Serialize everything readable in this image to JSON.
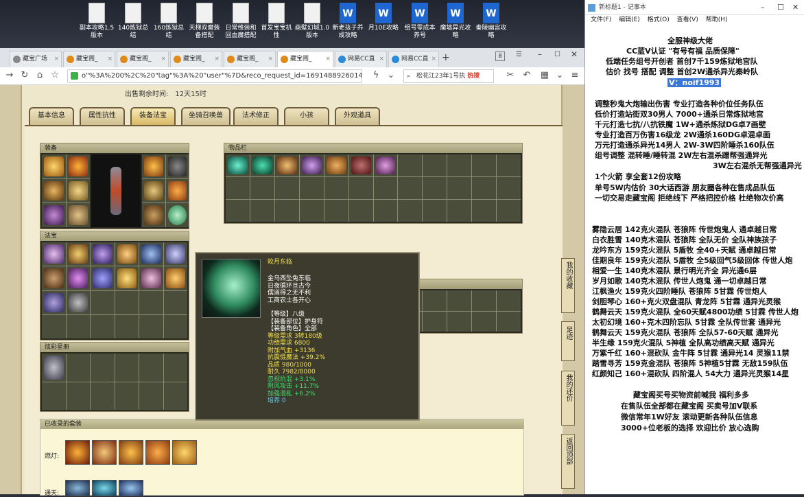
{
  "desktop": {
    "icons": [
      {
        "label": "副本攻略1.5版本",
        "type": "doc"
      },
      {
        "label": "140炼狱总结",
        "type": "doc"
      },
      {
        "label": "160炼狱总结",
        "type": "doc"
      },
      {
        "label": "天梯双魔装备搭配",
        "type": "doc"
      },
      {
        "label": "日常维装和回血魔搭配",
        "type": "doc"
      },
      {
        "label": "首发宝宝机性",
        "type": "doc"
      },
      {
        "label": "画壁幻城1.0版本",
        "type": "doc"
      },
      {
        "label": "新老孩子养成攻略",
        "type": "word"
      },
      {
        "label": "月10E攻略",
        "type": "word"
      },
      {
        "label": "组号零成本养号",
        "type": "word"
      },
      {
        "label": "魔墟异光攻略",
        "type": "word"
      },
      {
        "label": "秦陵幽宫攻略",
        "type": "word"
      }
    ]
  },
  "browser": {
    "tabs": [
      {
        "label": "藏宝广场"
      },
      {
        "label": "藏宝阁_"
      },
      {
        "label": "藏宝阁_"
      },
      {
        "label": "藏宝阁_"
      },
      {
        "label": "藏宝阁_"
      },
      {
        "label": "藏宝阁_"
      },
      {
        "label": "网易CC直"
      },
      {
        "label": "网易CC直"
      }
    ],
    "tab_count": "8",
    "url": "o\"%3A%200%2C%20\"tag\"%3A%20\"user\"%7D&reco_request_id=1691488926014emeD5",
    "search_text": "松花江23年1号执",
    "search_hot": "热搜"
  },
  "game": {
    "sale_label": "出售剩余时间:",
    "sale_time": "12天15时",
    "tabs": [
      "基本信息",
      "属性抗性",
      "装备法宝",
      "坐骑召唤兽",
      "法术修正",
      "小孩",
      "外观道具"
    ],
    "active_tab": "装备法宝",
    "panels": {
      "equipment": "装备",
      "inventory": "物品栏",
      "treasure": "法宝",
      "star": "炫彩星册",
      "sets": "已收录的套装"
    },
    "set_labels": [
      "燃灯:",
      "通天:"
    ],
    "tooltip": {
      "name": "皎月东临",
      "desc": [
        "金乌西坠兔东临",
        "日夜循环旦古今",
        "儒道得之无不利",
        "工商农士各开心"
      ],
      "level": "【等级】八级",
      "part": "【装备部位】护身符",
      "role": "【装备角色】全部",
      "stats_yellow": [
        "等级需求 3转180级",
        "功绩需求 6800",
        "附加气血 +3136",
        "抗震慑魔法 +39.2%",
        "品质 980/1000",
        "耐久 7982/8000"
      ],
      "stats_green": [
        "忽视抗混 +3.1%",
        "附风攻击 +11.7%",
        "加强混乱 +6.2%"
      ],
      "nurture": "培养 0"
    },
    "side_buttons": [
      "我的收藏",
      "足迹",
      "我的还价",
      "返回顶部"
    ]
  },
  "notepad": {
    "title": "新标题1 - 记事本",
    "menu": [
      "文件(F)",
      "编辑(E)",
      "格式(O)",
      "查看(V)",
      "帮助(H)"
    ],
    "lines": [
      "全服神级大佬",
      "CC蓝V认证 \"有号有福 品质保障\"",
      "低端任务组号开创者         首创7千159炼狱地宫队",
      "估价 找号 搭配 调整         首创2W通杀异光秦岭队",
      "V：noif1993",
      "调整秒鬼大炮输出伤害          专业打造各种价位任务队伍",
      "低价打造站街双30男人           7000+通杀日常炼狱地宫",
      "千元打造七抗/八抗铁魔           1W+通杀炼狱DG卓7画壁",
      "专业打造百万伤害16级龙         2W通杀160DG卓混卓画",
      "万元打造通杀异光14男人        2W-3W四阶睡杀160队伍",
      "组号调整 混转睡/睡转混          2W左右混杀蹭帮强通异光",
      "3W左右混杀无帮强通异光",
      "1个火箭 享全套12份攻略",
      "单号5W内估价 30大话西游        朋友圈各种在售成品队伍",
      "一切交易走藏宝阁 拒绝线下    严格把控价格 杜绝物次价高",
      "雾隐云居 142克火混队 苍狼阵 传世炮鬼人 通卓越日常",
      "白衣胜雪 140克木混队 苍狼阵 全队无价 全队神族孩子",
      "龙吟东方 159克火混队 5盾牧 全40+天赋 通卓越日常",
      "佳期良年 159克火混队 5盾牧 全5级回气5级回体 传世人炮",
      "相爱一生 140克木混队 景行明光齐全 异光通6层",
      "岁月如歌 140克木混队 传世人炮鬼 通一切卓越日常",
      "江枫渔火 159克火四阶睡队 苍狼阵 5甘霖 传世炮人",
      "剑胆琴心 160+克火双盘混队 青龙阵 5甘霖 通异光灵猴",
      "鹤舞云天 159克火混队 全60天赋4800功绩 5甘霖 传世人炮",
      "太初幻境 160+克木四阶忘队 5甘霖 全队传世套 通异光",
      "鹤舞云天 159克火混队 苍狼阵 全队57-60天赋 通异光",
      "半生缘   159克火混队 5神植 全队高功绩高天赋 通异光",
      "万紫千红 160+混砍队 金牛阵 5甘霖 通异光14 灵猴11禁",
      "踏雪寻芳 159克金混队 苍狼阵 5神植5甘霖 无敌159队伍",
      "红颜知己 160+混砍队 四阶混人 54大力 通异光灵猴14星",
      "藏宝阁买号买物资前喊我 福利多多",
      "在售队伍全部都在藏宝阁 买卖号加V联系",
      "微信常年1W好友 滚动更新各种队伍信息",
      "3000+位老板的选择 欢迎比价 放心选购"
    ]
  },
  "colors": {
    "tooltip_yellow": "#f2e04a",
    "tooltip_green": "#3be06c",
    "tooltip_cyan": "#5ad2ff",
    "gold": "#c9a35a",
    "highlight": "#3a77d6"
  }
}
